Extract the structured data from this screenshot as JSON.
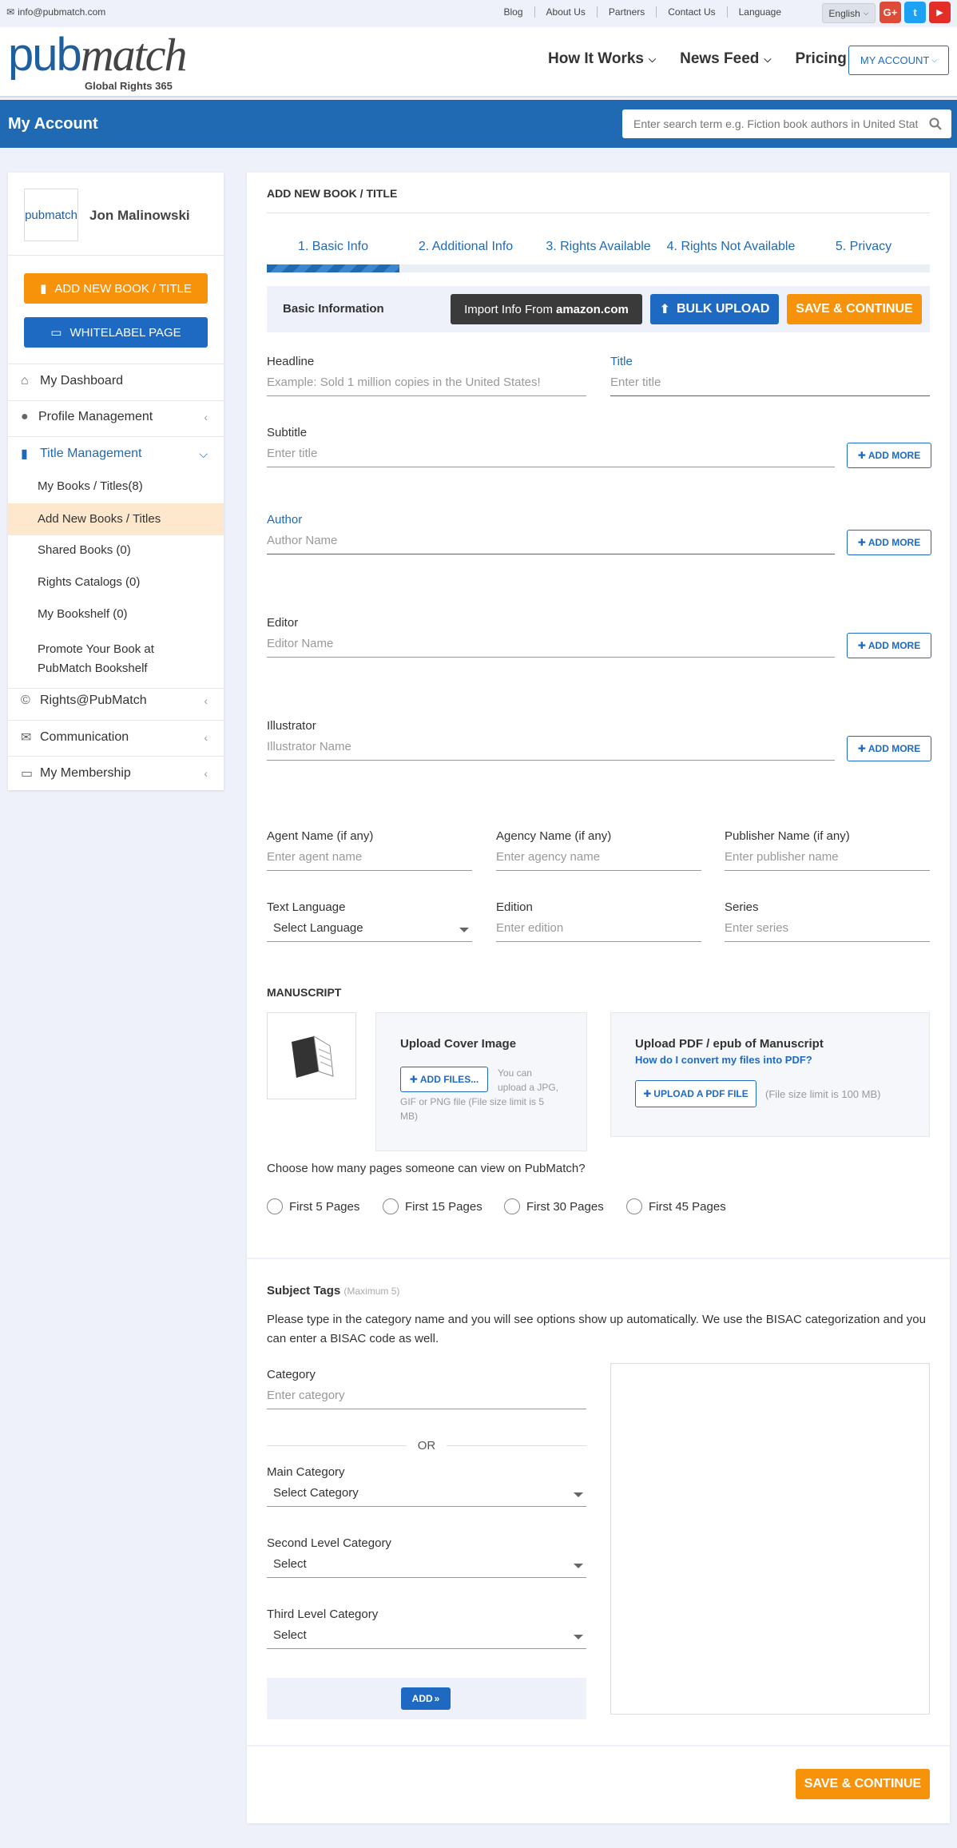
{
  "topbar": {
    "email": "info@pubmatch.com",
    "links": [
      "Blog",
      "About Us",
      "Partners",
      "Contact Us",
      "Language"
    ],
    "language": "English",
    "social": [
      {
        "icon": "google-plus-icon",
        "glyph": "G+",
        "color": "#dd4b39"
      },
      {
        "icon": "twitter-icon",
        "glyph": "t",
        "color": "#1da1f2"
      },
      {
        "icon": "youtube-icon",
        "glyph": "▶",
        "color": "#e52d27"
      }
    ]
  },
  "header": {
    "logo_brand": "pubmatch",
    "logo_tagline": "Global Rights 365",
    "nav": [
      "How It Works",
      "News Feed",
      "Pricing"
    ],
    "account_button": "MY ACCOUNT"
  },
  "subheader": {
    "title": "My Account",
    "search_placeholder": "Enter search term e.g. Fiction book authors in United States"
  },
  "sidebar": {
    "avatar_text": "pubmatch",
    "user_name": "Jon Malinowski",
    "add_book_button": "ADD NEW BOOK / TITLE",
    "whitelabel_button": "WHITELABEL PAGE",
    "menu": {
      "dashboard": "My Dashboard",
      "profile": "Profile Management",
      "title_mgmt": "Title Management",
      "rights": "Rights@PubMatch",
      "communication": "Communication",
      "membership": "My Membership"
    },
    "submenu": {
      "my_books": "My Books / Titles(8)",
      "add_new": "Add New Books / Titles",
      "shared": "Shared Books (0)",
      "catalogs": "Rights Catalogs (0)",
      "bookshelf": "My Bookshelf (0)",
      "promote_1": "Promote Your Book at",
      "promote_2": "PubMatch Bookshelf"
    }
  },
  "form": {
    "heading": "ADD NEW BOOK / TITLE",
    "tabs": [
      "1. Basic Info",
      "2. Additional Info",
      "3. Rights Available",
      "4. Rights Not Available",
      "5. Privacy"
    ],
    "section_label": "Basic Information",
    "import_button": "Import Info From",
    "import_brand": "amazon.com",
    "bulk_button": "BULK UPLOAD",
    "save_button": "SAVE & CONTINUE",
    "headline_label": "Headline",
    "headline_placeholder": "Example: Sold 1 million copies in the United States!",
    "title_label": "Title",
    "title_placeholder": "Enter title",
    "subtitle_label": "Subtitle",
    "subtitle_placeholder": "Enter title",
    "author_label": "Author",
    "author_placeholder": "Author Name",
    "editor_label": "Editor",
    "editor_placeholder": "Editor Name",
    "illustrator_label": "Illustrator",
    "illustrator_placeholder": "Illustrator Name",
    "add_more": "ADD MORE",
    "agent_label": "Agent Name (if any)",
    "agent_placeholder": "Enter agent name",
    "agency_label": "Agency Name (if any)",
    "agency_placeholder": "Enter agency name",
    "publisher_label": "Publisher Name (if any)",
    "publisher_placeholder": "Enter publisher name",
    "language_label": "Text Language",
    "language_value": "Select Language",
    "edition_label": "Edition",
    "edition_placeholder": "Enter edition",
    "series_label": "Series",
    "series_placeholder": "Enter series"
  },
  "manuscript": {
    "heading": "MANUSCRIPT",
    "cover_title": "Upload Cover Image",
    "add_files": "ADD FILES...",
    "cover_note_1": "You can",
    "cover_note_2": "upload a JPG,",
    "cover_note_3": "GIF or PNG file (File size limit is 5",
    "cover_note_4": "MB)",
    "pdf_title": "Upload PDF / epub of Manuscript",
    "pdf_link": "How do I convert my files into PDF?",
    "pdf_button": "UPLOAD A PDF FILE",
    "pdf_note": "(File size limit is 100 MB)",
    "pages_question": "Choose how many pages someone can view on PubMatch?",
    "page_options": [
      "First 5 Pages",
      "First 15 Pages",
      "First 30 Pages",
      "First 45 Pages"
    ]
  },
  "subject": {
    "heading": "Subject Tags",
    "max_note": "(Maximum 5)",
    "desc_1": "Please type in the category name and you will see options show up automatically. We use the BISAC categorization and you",
    "desc_2": "can enter a BISAC code as well.",
    "category_label": "Category",
    "category_placeholder": "Enter category",
    "or_text": "OR",
    "main_label": "Main Category",
    "main_value": "Select Category",
    "second_label": "Second Level Category",
    "second_value": "Select",
    "third_label": "Third Level Category",
    "third_value": "Select",
    "add_button": "ADD"
  },
  "footer_save": "SAVE & CONTINUE",
  "colors": {
    "primary": "#1f6ab2",
    "orange": "#f7930a",
    "bg": "#eef1f9"
  }
}
